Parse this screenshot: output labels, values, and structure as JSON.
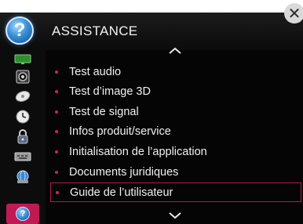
{
  "header": {
    "title": "ASSISTANCE",
    "help_glyph": "?",
    "close_glyph": "✕"
  },
  "sidebar": {
    "items": [
      {
        "icon": "tv-picture-icon",
        "color": "#3aa23a"
      },
      {
        "icon": "speaker-sound-icon",
        "color": "#d0d0d0"
      },
      {
        "icon": "satellite-dish-icon",
        "color": "#e6e6e6"
      },
      {
        "icon": "clock-time-icon",
        "color": "#e6e6e6"
      },
      {
        "icon": "lock-icon",
        "color": "#c9c9c9"
      },
      {
        "icon": "keyboard-option-icon",
        "color": "#bdbdbd"
      },
      {
        "icon": "network-globe-icon",
        "color": "#4a90d9"
      },
      {
        "icon": "support-help-icon",
        "color": "#c01a55",
        "active": true
      }
    ]
  },
  "menu": {
    "items": [
      {
        "label": "Test audio"
      },
      {
        "label": "Test d’image 3D"
      },
      {
        "label": "Test de signal"
      },
      {
        "label": "Infos produit/service"
      },
      {
        "label": "Initialisation de l’application"
      },
      {
        "label": "Documents juridiques"
      },
      {
        "label": "Guide de l’utilisateur",
        "selected": true
      }
    ]
  },
  "colors": {
    "accent": "#c01a55",
    "background": "#050505",
    "text": "#f0f0f0"
  }
}
